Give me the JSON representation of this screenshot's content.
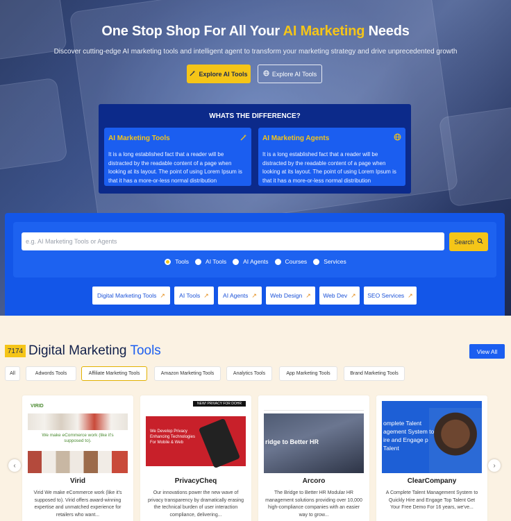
{
  "hero": {
    "title_pre": "One Stop Shop For All Your ",
    "title_accent": "AI Marketing",
    "title_post": " Needs",
    "subtitle": "Discover cutting-edge AI marketing tools and intelligent agent to transform your marketing strategy and drive unprecedented growth",
    "btn_primary": "Explore AI Tools",
    "btn_secondary": "Explore AI Tools"
  },
  "difference": {
    "title": "WHATS THE DIFFERENCE?",
    "cards": [
      {
        "title": "AI Marketing Tools",
        "icon": "magic-wand-icon",
        "text": "It is a long established fact that a reader will be distracted by the readable content of a page when looking at its layout. The point of using Lorem Ipsum is that it has a more-or-less normal distribution"
      },
      {
        "title": "AI Marketing Agents",
        "icon": "globe-icon",
        "text": "It is a long established fact that a reader will be distracted by the readable content of a page when looking at its layout. The point of using Lorem Ipsum is that it has a more-or-less normal distribution"
      }
    ]
  },
  "search": {
    "placeholder": "e.g. AI Marketing Tools or Agents",
    "button": "Search",
    "radios": [
      "Tools",
      "AI Tools",
      "AI Agents",
      "Courses",
      "Services"
    ],
    "selected": "Tools",
    "chips": [
      "Digital Marketing Tools",
      "AI Tools",
      "AI Agents",
      "Web Design",
      "Web Dev",
      "SEO Services"
    ]
  },
  "listing": {
    "count": "7174",
    "title_pre": "Digital Marketing ",
    "title_accent": "Tools",
    "view_all": "View All",
    "tabs": [
      "All",
      "Adwords Tools",
      "Affiliate Marketing Tools",
      "Amazon Marketing Tools",
      "Analytics Tools",
      "App Marketing Tools",
      "Brand Marketing Tools"
    ],
    "active_tab": "Affiliate Marketing Tools",
    "cards": [
      {
        "name": "Virid",
        "desc": "Virid We make eCommerce work (like it's supposed to). Virid offers award-winning expertise and unmatched experience for retailers who want..."
      },
      {
        "name": "PrivacyCheq",
        "desc": "Our innovations power the new wave of privacy transparency by dramatically erasing the technical burden of user interaction compliance, delivering..."
      },
      {
        "name": "Arcoro",
        "desc": "The Bridge to Better HR Modular HR management solutions providing over 10,000 high-compliance companies with an easier way to grow..."
      },
      {
        "name": "ClearCompany",
        "desc": "A Complete Talent Management System to Quickly Hire and Engage Top Talent Get Your Free Demo For 16 years, we've..."
      }
    ],
    "thumbs": {
      "virid_logo": "VIRID",
      "virid_tagline": "We make eCommerce work (like it's supposed to).",
      "privacy_banner": "NEW! PRIVACY FOR DOHR",
      "privacy_headline": "We Develop Privacy Enhancing Technologies For Mobile & Web",
      "arcoro_headline": "ridge to Better HR",
      "clear_headline": "omplete Talent agement System to ire and Engage p Talent"
    }
  },
  "colors": {
    "brand_blue": "#1b5ef0",
    "accent_yellow": "#f5c518",
    "navy": "#0c2a8a"
  }
}
